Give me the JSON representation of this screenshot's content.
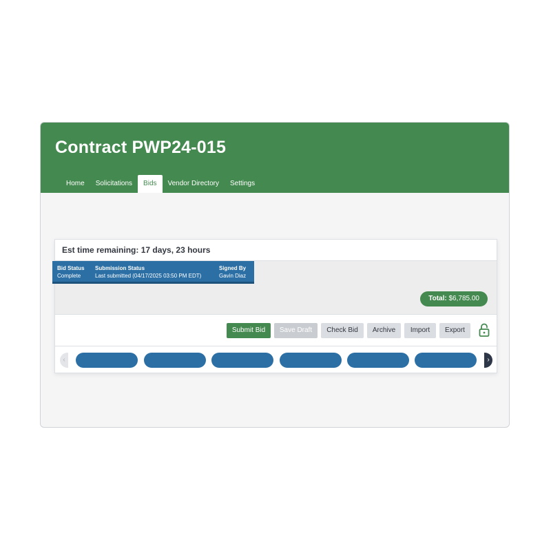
{
  "header": {
    "title": "Contract PWP24-015",
    "tabs": [
      {
        "label": "Home",
        "active": false
      },
      {
        "label": "Solicitations",
        "active": false
      },
      {
        "label": "Bids",
        "active": true
      },
      {
        "label": "Vendor Directory",
        "active": false
      },
      {
        "label": "Settings",
        "active": false
      }
    ]
  },
  "card": {
    "time_remaining": "Est time remaining: 17 days, 23 hours",
    "status": {
      "bid_status_label": "Bid Status",
      "bid_status_value": "Complete",
      "submission_status_label": "Submission Status",
      "submission_status_value": "Last submitted (04/17/2025 03:50 PM EDT)",
      "signed_by_label": "Signed By",
      "signed_by_value": "Gavin Diaz"
    },
    "total": {
      "label": "Total:",
      "value": "$6,785.00"
    },
    "actions": {
      "submit": "Submit Bid",
      "save_draft": "Save Draft",
      "check": "Check Bid",
      "archive": "Archive",
      "import": "Import",
      "export": "Export",
      "lock_icon": "unlocked-padlock-icon"
    },
    "scroller": {
      "left_arrow": "‹",
      "right_arrow": "›",
      "pill_count": 6
    }
  },
  "colors": {
    "brand_green": "#44894f",
    "accent_blue": "#2b6fa5",
    "dark_arrow": "#2e3748"
  }
}
